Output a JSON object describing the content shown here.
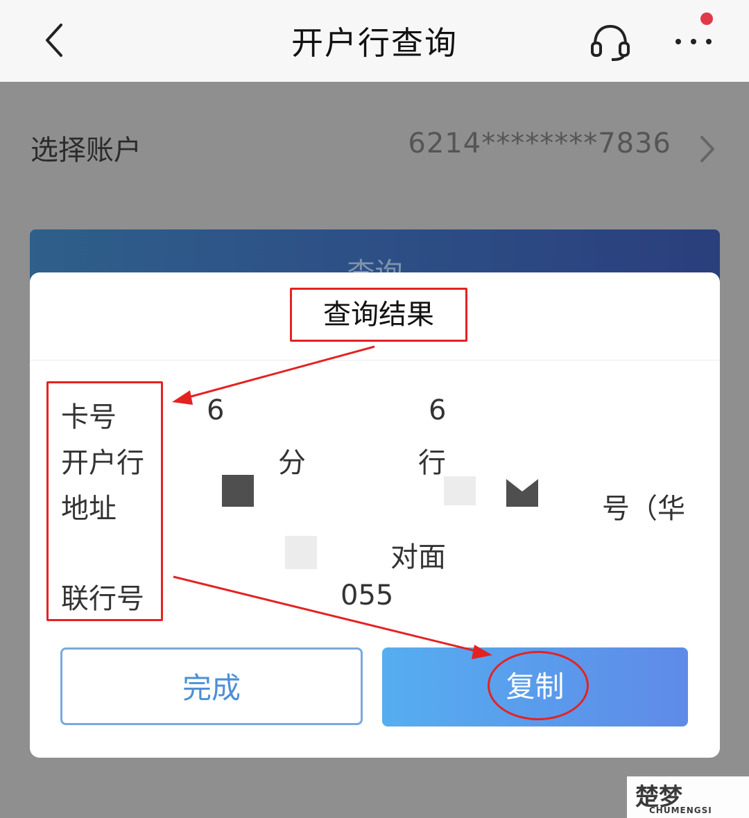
{
  "header": {
    "title": "开户行查询",
    "back_icon": "chevron-left-icon",
    "service_icon": "headset-icon",
    "more_icon": "more-dots-icon",
    "notification_dot_color": "#e2394a"
  },
  "account": {
    "label": "选择账户",
    "number": "6214********7836"
  },
  "query_button": {
    "label": "查询"
  },
  "dialog": {
    "title": "查询结果",
    "fields": [
      {
        "label": "卡号",
        "value": "6",
        "value_tail": "6"
      },
      {
        "label": "开户行",
        "value": "分",
        "value_tail": "行"
      },
      {
        "label": "地址",
        "value": "号（华",
        "value_line2": "对面"
      },
      {
        "label": "联行号",
        "value": "055"
      }
    ],
    "done_label": "完成",
    "copy_label": "复制"
  },
  "annotation_color": "#e42222",
  "watermark": {
    "main": "楚梦",
    "sub": "CHUMENGSI"
  }
}
